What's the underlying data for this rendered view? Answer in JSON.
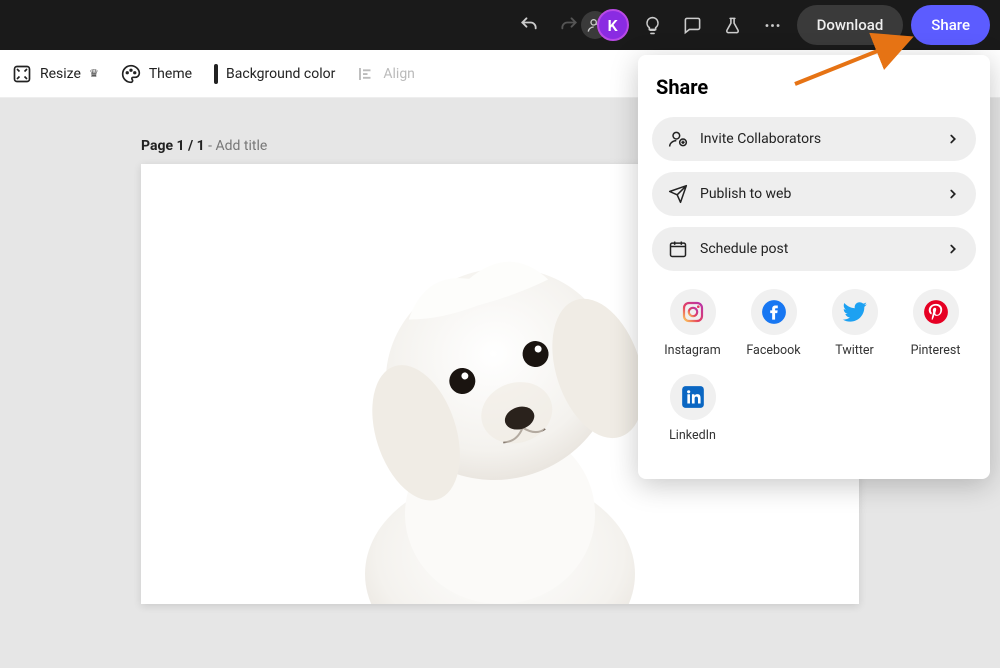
{
  "header": {
    "download_label": "Download",
    "share_label": "Share",
    "avatar_initial": "K"
  },
  "toolbar": {
    "resize": "Resize",
    "theme": "Theme",
    "bgcolor": "Background color",
    "align": "Align"
  },
  "page": {
    "page_prefix": "Page 1 / 1",
    "sep": " - ",
    "title_placeholder": "Add title"
  },
  "share_panel": {
    "title": "Share",
    "rows": [
      {
        "label": "Invite Collaborators"
      },
      {
        "label": "Publish to web"
      },
      {
        "label": "Schedule post"
      }
    ],
    "socials": [
      {
        "label": "Instagram"
      },
      {
        "label": "Facebook"
      },
      {
        "label": "Twitter"
      },
      {
        "label": "Pinterest"
      },
      {
        "label": "LinkedIn"
      }
    ]
  }
}
